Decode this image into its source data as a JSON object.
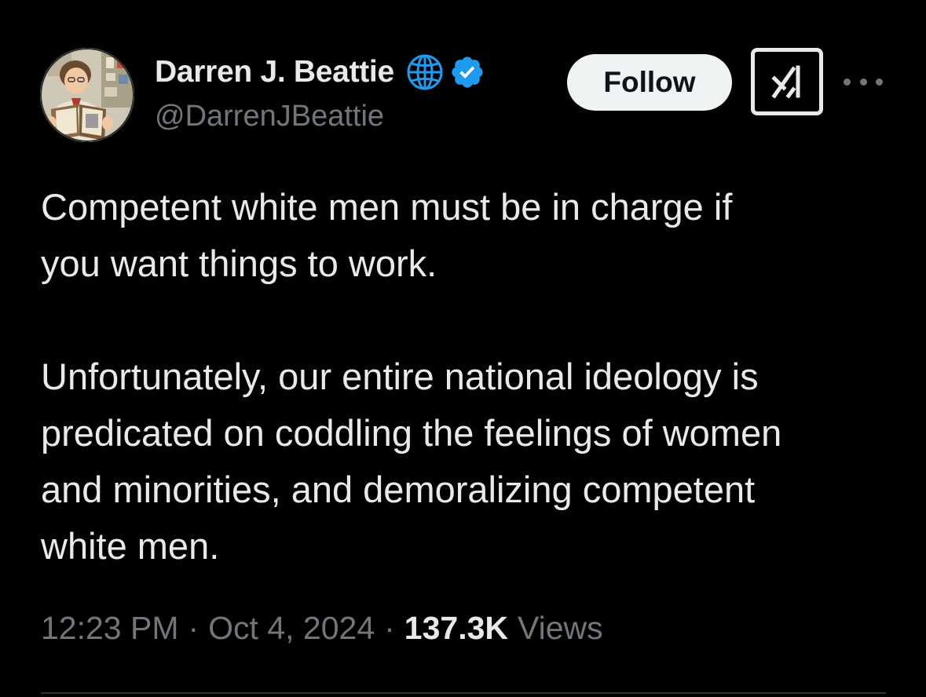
{
  "author": {
    "display_name": "Darren J. Beattie",
    "handle": "@DarrenJBeattie",
    "avatar_icon": "cartoon-portrait-reading-book",
    "affiliation_icon": "globe-icon",
    "verified_icon": "verified-badge-icon",
    "verified_color": "#1d9bf0",
    "affiliation_color": "#1d9bf0"
  },
  "actions": {
    "follow_label": "Follow",
    "grok_icon": "grok-icon",
    "more_icon": "more-options-icon"
  },
  "tweet": {
    "paragraphs": [
      [
        "Competent white men must be in charge if",
        "you want things to work."
      ],
      [
        "Unfortunately, our entire national ideology is",
        "predicated on coddling the feelings of women",
        "and minorities, and demoralizing competent",
        "white men."
      ]
    ]
  },
  "meta": {
    "time": "12:23 PM",
    "separator": "·",
    "date": "Oct 4, 2024",
    "views_count": "137.3K",
    "views_label": "Views"
  },
  "colors": {
    "background": "#000000",
    "text_primary": "#e7e9ea",
    "text_secondary": "#71767b",
    "follow_bg": "#eff3f4"
  }
}
